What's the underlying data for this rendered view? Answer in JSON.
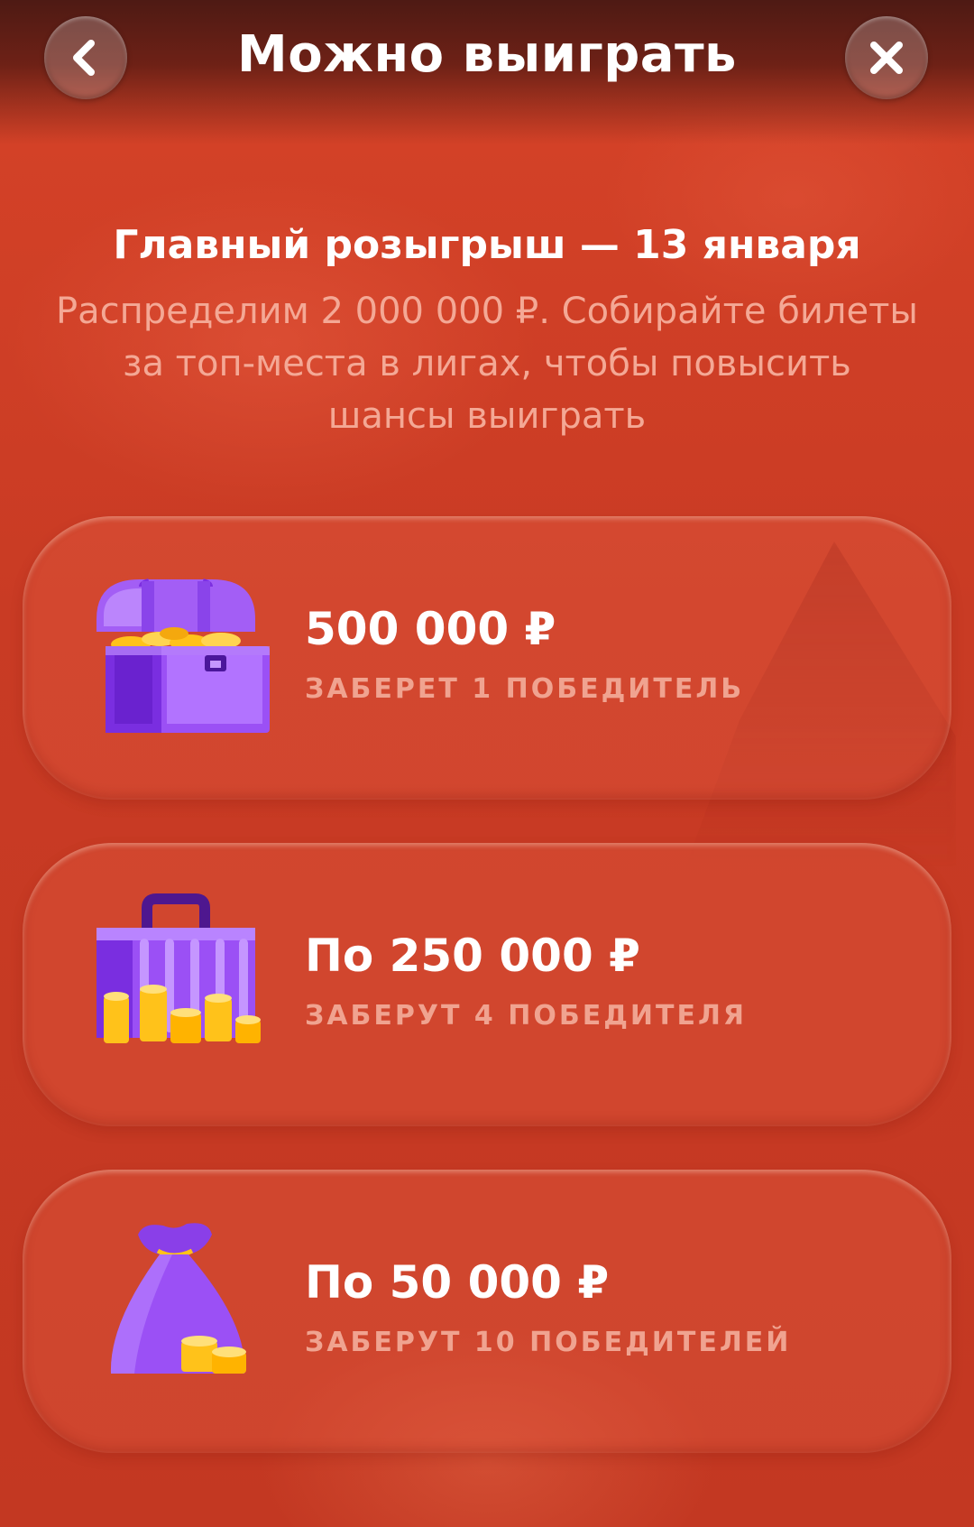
{
  "header": {
    "title": "Можно выиграть",
    "back_icon": "chevron-left-icon",
    "close_icon": "close-icon"
  },
  "intro": {
    "heading": "Главный розыгрыш — 13 января",
    "description": "Распределим 2 000 000 ₽. Собирайте билеты за топ-места в лигах, чтобы повысить шансы выиграть"
  },
  "prizes": [
    {
      "icon": "treasure-chest-icon",
      "amount": "500 000 ₽",
      "winners": "ЗАБЕРЕТ 1 ПОБЕДИТЕЛЬ"
    },
    {
      "icon": "money-case-icon",
      "amount": "По 250 000 ₽",
      "winners": "ЗАБЕРУТ 4 ПОБЕДИТЕЛЯ"
    },
    {
      "icon": "money-bag-icon",
      "amount": "По 50 000 ₽",
      "winners": "ЗАБЕРУТ 10 ПОБЕДИТЕЛЕЙ"
    }
  ],
  "colors": {
    "background": "#c43a24",
    "header": "#5a1c15",
    "illustration_purple": "#8b3ff0",
    "coins": "#ffc21a",
    "subtitle": "#f4a895"
  }
}
